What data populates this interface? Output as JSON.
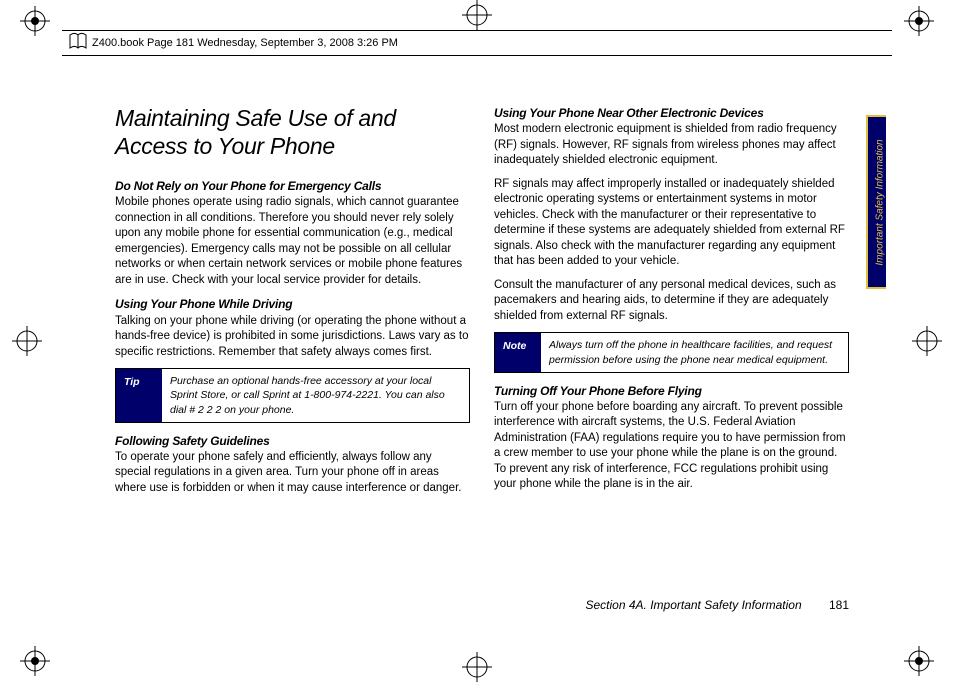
{
  "header": {
    "text": "Z400.book  Page 181  Wednesday, September 3, 2008  3:26 PM"
  },
  "sideTab": "Important Safety Information",
  "footer": {
    "section": "Section 4A. Important Safety Information",
    "page": "181"
  },
  "col1": {
    "title": "Maintaining Safe Use of and Access to Your Phone",
    "h1": "Do Not Rely on Your Phone for Emergency Calls",
    "p1": "Mobile phones operate using radio signals, which cannot guarantee connection in all conditions. Therefore you should never rely solely upon any mobile phone for essential communication (e.g., medical emergencies). Emergency calls may not be possible on all cellular networks or when certain network services or mobile phone features are in use. Check with your local service provider for details.",
    "h2": "Using Your Phone While Driving",
    "p2": "Talking on your phone while driving (or operating the phone without a hands-free device) is prohibited in some jurisdictions. Laws vary as to specific restrictions. Remember that safety always comes first.",
    "tipLabel": "Tip",
    "tipText": "Purchase an optional hands-free accessory at your local Sprint Store, or call Sprint at 1-800-974-2221. You can also dial # 2 2 2 on your phone.",
    "h3": "Following Safety Guidelines",
    "p3": "To operate your phone safely and efficiently, always follow any special regulations in a given area. Turn your phone off in areas where use is forbidden or when it may cause interference or danger."
  },
  "col2": {
    "h1": "Using Your Phone Near Other Electronic Devices",
    "p1": "Most modern electronic equipment is shielded from radio frequency (RF) signals. However, RF signals from wireless phones may affect inadequately shielded electronic equipment.",
    "p2": "RF signals may affect improperly installed or inadequately shielded electronic operating systems or entertainment systems in motor vehicles. Check with the manufacturer or their representative to determine if these systems are adequately shielded from external RF signals. Also check with the manufacturer regarding any equipment that has been added to your vehicle.",
    "p3": "Consult the manufacturer of any personal medical devices, such as pacemakers and hearing aids, to determine if they are adequately shielded from external RF signals.",
    "noteLabel": "Note",
    "noteText": "Always turn off the phone in healthcare facilities, and request permission before using the phone near medical equipment.",
    "h2": "Turning Off Your Phone Before Flying",
    "p4": "Turn off your phone before boarding any aircraft. To prevent possible interference with aircraft systems, the U.S. Federal Aviation Administration (FAA) regulations require you to have permission from a crew member to use your phone while the plane is on the ground. To prevent any risk of interference, FCC regulations prohibit using your phone while the plane is in the air."
  }
}
